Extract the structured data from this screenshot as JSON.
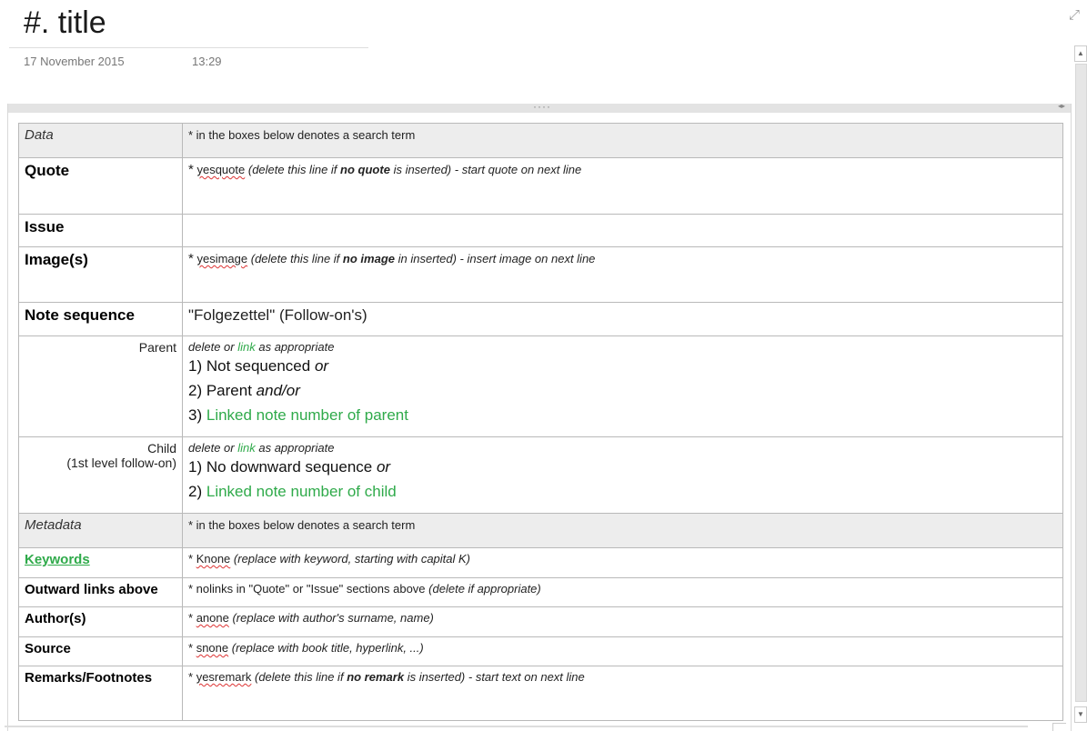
{
  "page": {
    "title": "#. title",
    "date": "17 November 2015",
    "time": "13:29"
  },
  "icons": {
    "expand": "expand-arrows-icon",
    "drag": "drag-handle-icon",
    "resize": "resize-handle-icon",
    "scroll_up": "scroll-up-icon",
    "scroll_down": "scroll-down-icon"
  },
  "colors": {
    "link_green": "#2faa4a",
    "shaded_row": "#ededed",
    "spellcheck_red": "#d33"
  },
  "table": {
    "data_header": {
      "label": "Data",
      "note": "* in the boxes below denotes a search term"
    },
    "quote": {
      "label": "Quote",
      "star": "*",
      "term": "yesquote",
      "hint_a": "(delete this line if",
      "hint_b": "no quote",
      "hint_c": "is inserted) - start quote on next line"
    },
    "issue": {
      "label": "Issue"
    },
    "image": {
      "label": "Image(s)",
      "star": "*",
      "term": "yesimage",
      "hint_a": "(delete this line if",
      "hint_b": "no image",
      "hint_c": "in inserted) - insert image on next line"
    },
    "note_sequence": {
      "label": "Note sequence",
      "value": "\"Folgezettel\" (Follow-on's)"
    },
    "parent": {
      "label": "Parent",
      "hint_a": "delete or",
      "hint_link": "link",
      "hint_b": "as appropriate",
      "line1": "1) Not sequenced",
      "line1_it": "or",
      "line2": "2) Parent",
      "line2_it": "and/or",
      "line3_num": "3)",
      "line3_link": "Linked note number of parent"
    },
    "child": {
      "label": "Child",
      "sublabel": "(1st level follow-on)",
      "hint_a": "delete or",
      "hint_link": "link",
      "hint_b": "as appropriate",
      "line1": "1) No downward sequence",
      "line1_it": "or",
      "line2_num": "2)",
      "line2_link": "Linked note number of child"
    },
    "metadata_header": {
      "label": "Metadata",
      "note": "* in the boxes below denotes a search term"
    },
    "keywords": {
      "label": "Keywords",
      "star": "*",
      "term": "Knone",
      "hint": "(replace with keyword, starting with capital K)"
    },
    "outward": {
      "label": "Outward links above",
      "text": "* nolinks in \"Quote\" or \"Issue\" sections above",
      "hint": "(delete if appropriate)"
    },
    "authors": {
      "label": "Author(s)",
      "star": "*",
      "term": "anone",
      "hint": "(replace with author's surname, name)"
    },
    "source": {
      "label": "Source",
      "star": "*",
      "term": "snone",
      "hint": "(replace with book title, hyperlink, ...)"
    },
    "remarks": {
      "label": "Remarks/Footnotes",
      "star": "*",
      "term": "yesremark",
      "hint_a": "(delete this line if",
      "hint_b": "no remark",
      "hint_c": "is inserted) - start text on next line"
    }
  }
}
